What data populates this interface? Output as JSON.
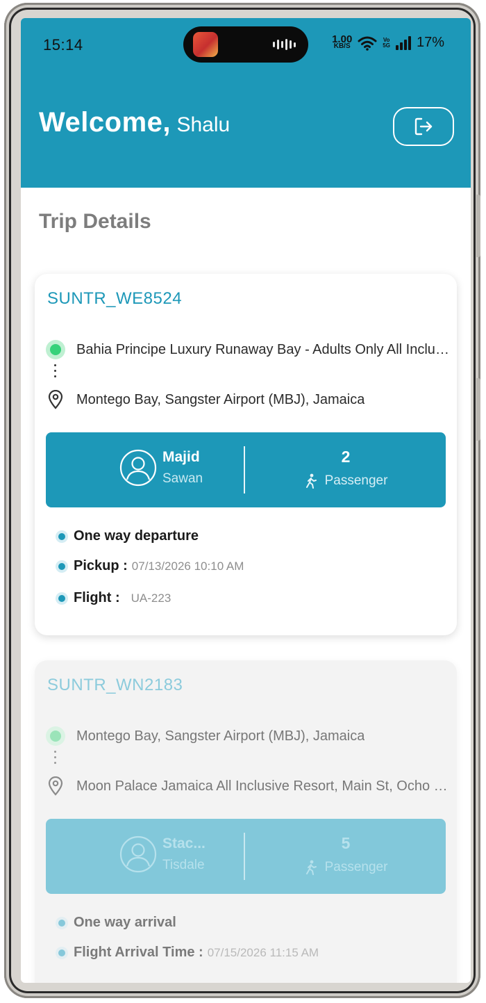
{
  "status_bar": {
    "time": "15:14",
    "net_speed_value": "1.00",
    "net_speed_unit": "KB/S",
    "volte_line1": "Vo",
    "volte_line2": "5G",
    "battery": "17%"
  },
  "header": {
    "welcome": "Welcome,",
    "user_name": "Shalu",
    "logout_icon": "logout-icon",
    "background_color": "#1d98b8"
  },
  "section_title": "Trip Details",
  "trips": [
    {
      "id": "SUNTR_WE8524",
      "origin": "Bahia Principe Luxury Runaway Bay - Adults Only All Inclusive",
      "destination": "Montego Bay, Sangster Airport (MBJ), Jamaica",
      "driver_first": "Majid",
      "driver_last": "Sawan",
      "passenger_count": "2",
      "passenger_label": "Passenger",
      "trip_type": "One way departure",
      "time_label": "Pickup :",
      "time_value": "07/13/2026 10:10 AM",
      "flight_label": "Flight :",
      "flight_value": "UA-223"
    },
    {
      "id": "SUNTR_WN2183",
      "origin": "Montego Bay, Sangster Airport (MBJ), Jamaica",
      "destination": "Moon Palace Jamaica All Inclusive Resort, Main St, Ocho Rios",
      "driver_first": "Stac...",
      "driver_last": "Tisdale",
      "passenger_count": "5",
      "passenger_label": "Passenger",
      "trip_type": "One way arrival",
      "time_label": "Flight Arrival Time :",
      "time_value": "07/15/2026 11:15 AM"
    }
  ]
}
